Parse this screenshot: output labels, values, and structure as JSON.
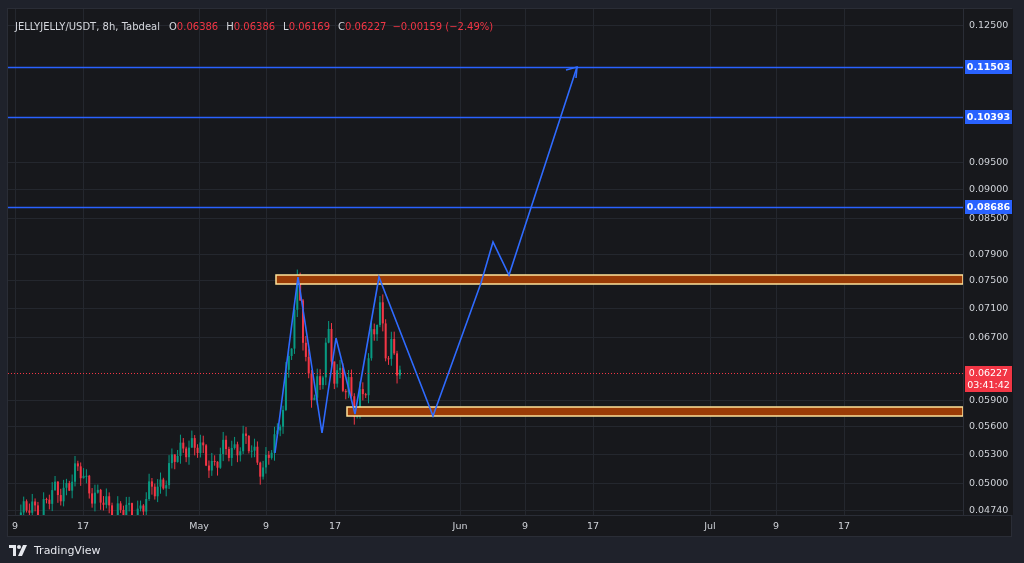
{
  "legend": {
    "symbol": "JELLYJELLY/USDT, 8h, Tabdeal",
    "falling": true,
    "ohlc": [
      {
        "label": "O",
        "value": "0.06386"
      },
      {
        "label": "H",
        "value": "0.06386"
      },
      {
        "label": "L",
        "value": "0.06169"
      },
      {
        "label": "C",
        "value": "0.06227"
      }
    ],
    "change": "−0.00159 (−2.49%)"
  },
  "price_axis": {
    "labels": [
      "0.12500",
      "0.09500",
      "0.09000",
      "0.08500",
      "0.07900",
      "0.07500",
      "0.07100",
      "0.06700",
      "0.05900",
      "0.05600",
      "0.05300",
      "0.05000",
      "0.04740"
    ]
  },
  "levels": [
    {
      "price": "0.11503"
    },
    {
      "price": "0.10393"
    },
    {
      "price": "0.08686"
    }
  ],
  "current_price": {
    "price": "0.06227",
    "countdown": "03:41:42",
    "falling": true
  },
  "time_axis": {
    "labels": [
      "9",
      "17",
      "May",
      "9",
      "17",
      "Jun",
      "9",
      "17",
      "Jul",
      "9",
      "17"
    ]
  },
  "footer": {
    "brand": "TradingView"
  }
}
